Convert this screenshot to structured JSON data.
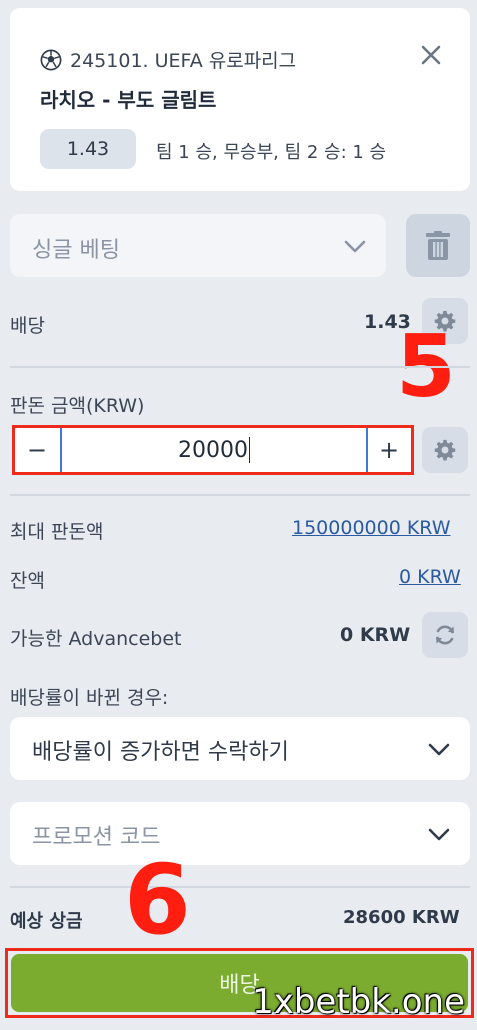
{
  "event": {
    "league": "245101. UEFA 유로파리그",
    "match": "라치오 - 부도 글림트",
    "odds": "1.43",
    "outcome": "팀 1 승, 무승부, 팀 2 승: 1 승"
  },
  "bet_type": {
    "label": "싱글 베팅"
  },
  "odds_row": {
    "label": "배당",
    "value": "1.43"
  },
  "stake": {
    "label": "판돈 금액(KRW)",
    "value": "20000",
    "minus": "−",
    "plus": "+"
  },
  "max_stake": {
    "label": "최대 판돈액",
    "value": "150000000 KRW"
  },
  "balance": {
    "label": "잔액",
    "value": "0 KRW"
  },
  "advancebet": {
    "label": "가능한 Advancebet",
    "value": "0 KRW"
  },
  "odds_change": {
    "label": "배당률이 바뀐 경우:",
    "selected": "배당률이 증가하면 수락하기"
  },
  "promo": {
    "label": "프로모션 코드"
  },
  "potential_win": {
    "label": "예상 상금",
    "value": "28600 KRW"
  },
  "place_button": {
    "label": "배당"
  },
  "annotations": {
    "step5": "5",
    "step6": "6"
  },
  "watermark": "1xbetbk.one",
  "icons": [
    "soccer-ball-icon",
    "close-icon",
    "chevron-down-icon",
    "trash-icon",
    "gear-icon",
    "refresh-icon"
  ],
  "colors": {
    "accent_green": "#7bac2f",
    "link_blue": "#2b5aa0",
    "annotation_red": "#ee2a1c"
  }
}
